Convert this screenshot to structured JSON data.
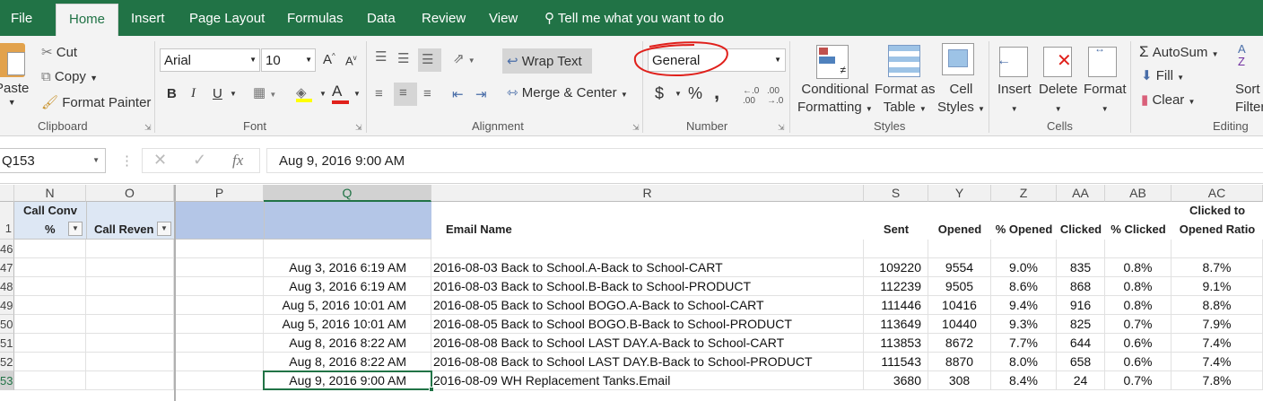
{
  "tabs": [
    {
      "label": "File",
      "active": false
    },
    {
      "label": "Home",
      "active": true
    },
    {
      "label": "Insert",
      "active": false
    },
    {
      "label": "Page Layout",
      "active": false
    },
    {
      "label": "Formulas",
      "active": false
    },
    {
      "label": "Data",
      "active": false
    },
    {
      "label": "Review",
      "active": false
    },
    {
      "label": "View",
      "active": false
    }
  ],
  "tell_me": "Tell me what you want to do",
  "clipboard": {
    "paste": "Paste",
    "cut": "Cut",
    "copy": "Copy",
    "format_painter": "Format Painter",
    "label": "Clipboard"
  },
  "font": {
    "name": "Arial",
    "size": "10",
    "bold": "B",
    "italic": "I",
    "underline": "U",
    "font_color": "A",
    "label": "Font"
  },
  "alignment": {
    "wrap_text": "Wrap Text",
    "merge_center": "Merge & Center",
    "label": "Alignment"
  },
  "number": {
    "format": "General",
    "currency": "$",
    "percent": "%",
    "comma": ",",
    "label": "Number"
  },
  "styles": {
    "conditional": "Conditional",
    "formatting": "Formatting",
    "format_as": "Format as",
    "table": "Table",
    "cell": "Cell",
    "cell_styles": "Styles",
    "label": "Styles"
  },
  "cells": {
    "insert": "Insert",
    "delete": "Delete",
    "format": "Format",
    "label": "Cells"
  },
  "editing": {
    "autosum": "AutoSum",
    "fill": "Fill",
    "clear": "Clear",
    "sort": "Sort",
    "filter": "Filter",
    "label": "Editing"
  },
  "formula_bar": {
    "name_box": "Q153",
    "fx": "fx",
    "value": "Aug 9, 2016 9:00 AM"
  },
  "columns": [
    {
      "letter": "N",
      "selected": false
    },
    {
      "letter": "O",
      "selected": false
    },
    {
      "letter": "P",
      "selected": false
    },
    {
      "letter": "Q",
      "selected": true
    },
    {
      "letter": "R",
      "selected": false
    },
    {
      "letter": "S",
      "selected": false
    },
    {
      "letter": "Y",
      "selected": false
    },
    {
      "letter": "Z",
      "selected": false
    },
    {
      "letter": "AA",
      "selected": false
    },
    {
      "letter": "AB",
      "selected": false
    },
    {
      "letter": "AC",
      "selected": false
    }
  ],
  "header_row": {
    "row_num": "1",
    "n_line1": "Call Conv",
    "n_line2": "%",
    "o": "Call Revenu",
    "r": "Email Name",
    "s": "Sent",
    "y": "Opened",
    "z": "% Opened",
    "aa": "Clicked",
    "ab": "% Clicked",
    "ac_line1": "Clicked to",
    "ac_line2": "Opened Ratio"
  },
  "rows": [
    {
      "num": "46",
      "date": "",
      "email": "",
      "sent": "",
      "opened": "",
      "pct_opened": "",
      "clicked": "",
      "pct_clicked": "",
      "ratio": ""
    },
    {
      "num": "47",
      "date": "Aug 3, 2016 6:19 AM",
      "email": "2016-08-03 Back to School.A-Back to School-CART",
      "sent": "109220",
      "opened": "9554",
      "pct_opened": "9.0%",
      "clicked": "835",
      "pct_clicked": "0.8%",
      "ratio": "8.7%"
    },
    {
      "num": "48",
      "date": "Aug 3, 2016 6:19 AM",
      "email": "2016-08-03 Back to School.B-Back to School-PRODUCT",
      "sent": "112239",
      "opened": "9505",
      "pct_opened": "8.6%",
      "clicked": "868",
      "pct_clicked": "0.8%",
      "ratio": "9.1%"
    },
    {
      "num": "49",
      "date": "Aug 5, 2016 10:01 AM",
      "email": "2016-08-05 Back to School BOGO.A-Back to School-CART",
      "sent": "111446",
      "opened": "10416",
      "pct_opened": "9.4%",
      "clicked": "916",
      "pct_clicked": "0.8%",
      "ratio": "8.8%"
    },
    {
      "num": "50",
      "date": "Aug 5, 2016 10:01 AM",
      "email": "2016-08-05 Back to School BOGO.B-Back to School-PRODUCT",
      "sent": "113649",
      "opened": "10440",
      "pct_opened": "9.3%",
      "clicked": "825",
      "pct_clicked": "0.7%",
      "ratio": "7.9%"
    },
    {
      "num": "51",
      "date": "Aug 8, 2016 8:22 AM",
      "email": "2016-08-08 Back to School LAST DAY.A-Back to School-CART",
      "sent": "113853",
      "opened": "8672",
      "pct_opened": "7.7%",
      "clicked": "644",
      "pct_clicked": "0.6%",
      "ratio": "7.4%"
    },
    {
      "num": "52",
      "date": "Aug 8, 2016 8:22 AM",
      "email": "2016-08-08 Back to School LAST DAY.B-Back to School-PRODUCT",
      "sent": "111543",
      "opened": "8870",
      "pct_opened": "8.0%",
      "clicked": "658",
      "pct_clicked": "0.6%",
      "ratio": "7.4%"
    },
    {
      "num": "53",
      "date": "Aug 9, 2016 9:00 AM",
      "email": "2016-08-09 WH Replacement Tanks.Email",
      "sent": "3680",
      "opened": "308",
      "pct_opened": "8.4%",
      "clicked": "24",
      "pct_clicked": "0.7%",
      "ratio": "7.8%"
    }
  ],
  "colors": {
    "accent": "#217346",
    "selection_header": "#b4c6e7",
    "annotation": "#e0201b"
  }
}
